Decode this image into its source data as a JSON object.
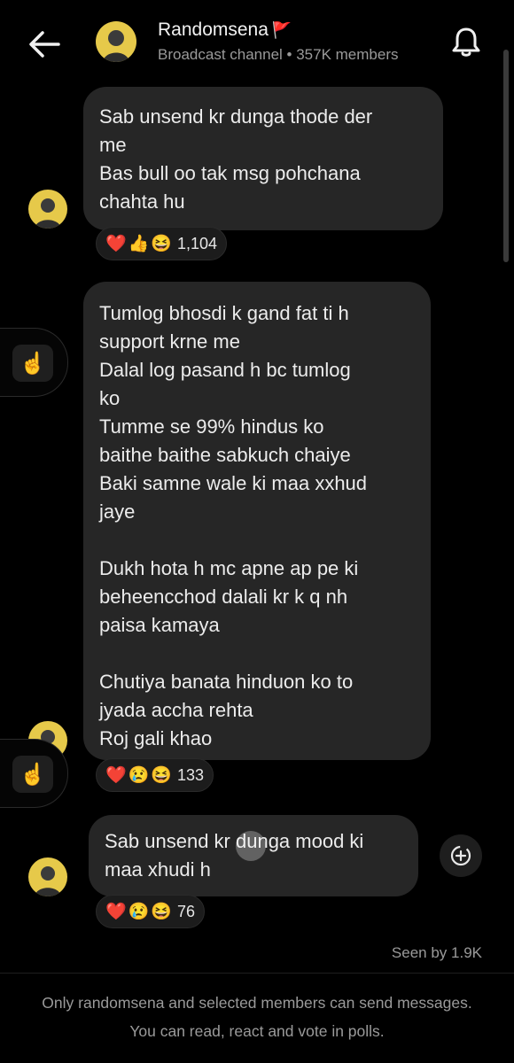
{
  "header": {
    "title": "Randomsena",
    "title_flag": "🚩",
    "subtitle": "Broadcast channel • 357K members"
  },
  "messages": [
    {
      "text": "Sab unsend kr dunga thode der\nme\nBas bull oo tak msg pohchana\nchahta hu",
      "reactions": {
        "emojis": [
          "❤️",
          "👍",
          "😆"
        ],
        "count": "1,104"
      }
    },
    {
      "text": "Tumlog bhosdi k gand fat ti h\nsupport krne me\nDalal log pasand h bc tumlog\nko\nTumme se 99% hindus ko\nbaithe baithe sabkuch chaiye\nBaki samne wale ki maa xxhud\njaye\n\nDukh hota h mc apne ap pe ki\nbeheencchod dalali kr k q nh\npaisa kamaya\n\nChutiya banata hinduon ko to\njyada accha rehta\nRoj gali khao",
      "reactions": {
        "emojis": [
          "❤️",
          "😢",
          "😆"
        ],
        "count": "133"
      }
    },
    {
      "text": "Sab unsend kr dunga mood ki\nmaa xhudi h",
      "reactions": {
        "emojis": [
          "❤️",
          "😢",
          "😆"
        ],
        "count": "76"
      }
    }
  ],
  "seen": "Seen by 1.9K",
  "footer": "Only randomsena and selected members can send messages. You can read, react and vote in polls.",
  "colors": {
    "background": "#000000",
    "bubble": "#262626",
    "avatar": "#e6c94a"
  },
  "icons": [
    "back-arrow-icon",
    "bell-icon",
    "tap-gesture-icon",
    "forward-icon"
  ]
}
